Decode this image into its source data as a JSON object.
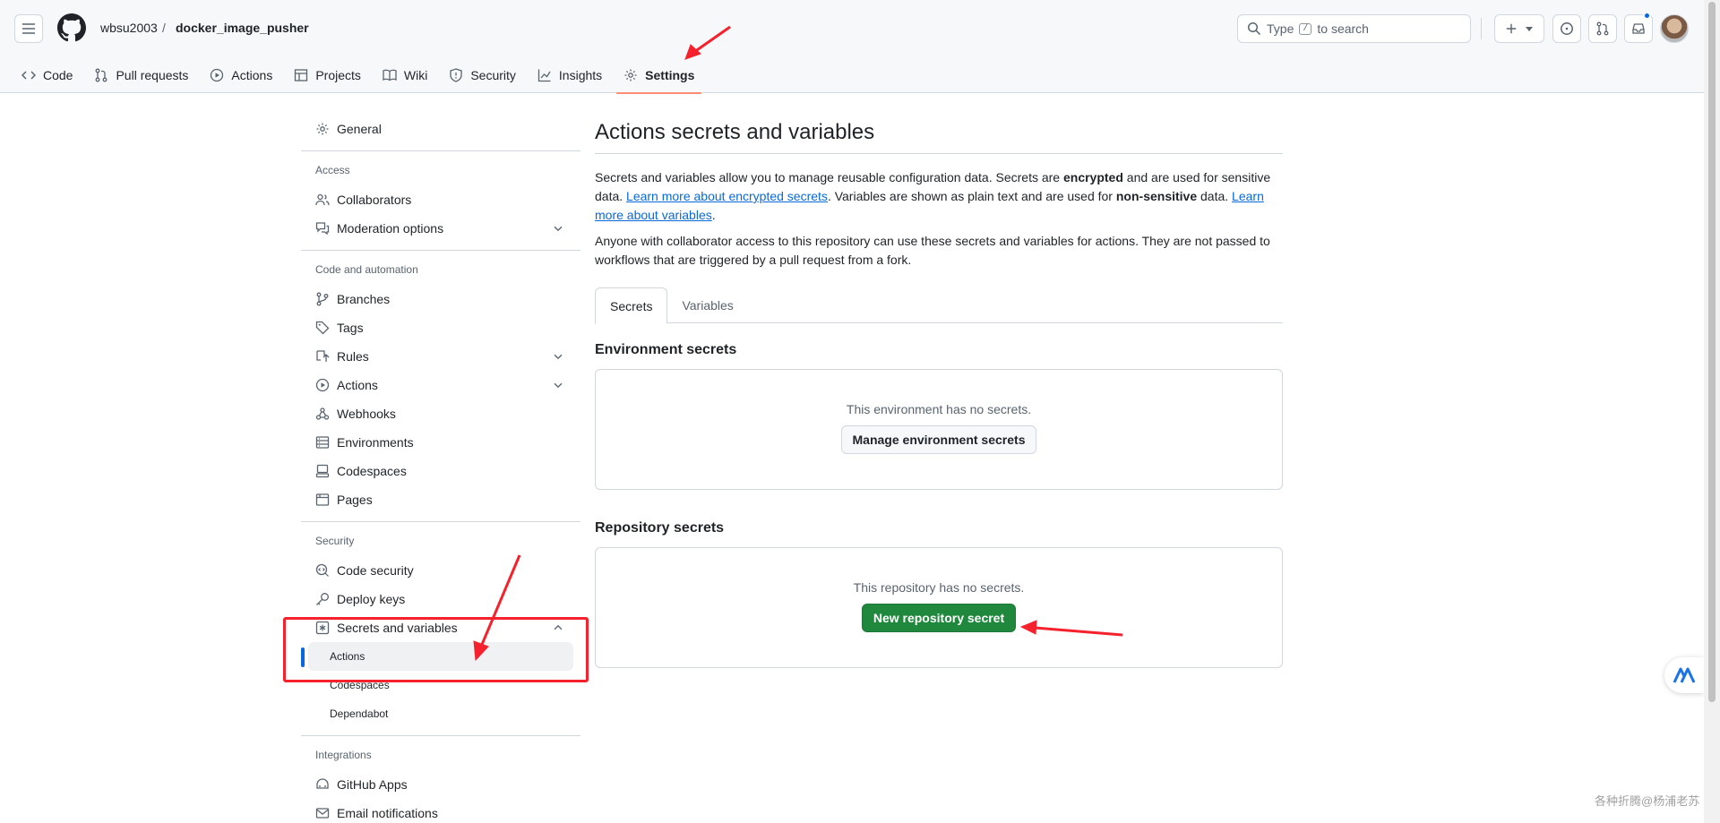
{
  "header": {
    "owner": "wbsu2003",
    "separator": "/",
    "repo": "docker_image_pusher",
    "search_prefix": "Type",
    "search_key": "/",
    "search_suffix": "to search"
  },
  "repo_nav": {
    "tabs": [
      {
        "label": "Code",
        "icon": "code-icon"
      },
      {
        "label": "Pull requests",
        "icon": "git-pull-request-icon"
      },
      {
        "label": "Actions",
        "icon": "play-icon"
      },
      {
        "label": "Projects",
        "icon": "table-icon"
      },
      {
        "label": "Wiki",
        "icon": "book-icon"
      },
      {
        "label": "Security",
        "icon": "shield-icon"
      },
      {
        "label": "Insights",
        "icon": "graph-icon"
      },
      {
        "label": "Settings",
        "icon": "gear-icon",
        "active": true
      }
    ]
  },
  "sidebar": {
    "general": "General",
    "access_heading": "Access",
    "collaborators": "Collaborators",
    "moderation": "Moderation options",
    "code_heading": "Code and automation",
    "branches": "Branches",
    "tags": "Tags",
    "rules": "Rules",
    "actions": "Actions",
    "webhooks": "Webhooks",
    "environments": "Environments",
    "codespaces": "Codespaces",
    "pages": "Pages",
    "security_heading": "Security",
    "code_security": "Code security",
    "deploy_keys": "Deploy keys",
    "secrets_vars": "Secrets and variables",
    "sub_actions": "Actions",
    "sub_codespaces": "Codespaces",
    "sub_dependabot": "Dependabot",
    "integrations_heading": "Integrations",
    "github_apps": "GitHub Apps",
    "email_notifications": "Email notifications"
  },
  "main": {
    "title": "Actions secrets and variables",
    "p1_a": "Secrets and variables allow you to manage reusable configuration data. Secrets are ",
    "p1_b": "encrypted",
    "p1_c": " and are used for sensitive data. ",
    "p1_link1": "Learn more about encrypted secrets",
    "p1_d": ". Variables are shown as plain text and are used for ",
    "p1_e": "non-sensitive",
    "p1_f": " data. ",
    "p1_link2": "Learn more about variables",
    "p1_g": ".",
    "p2": "Anyone with collaborator access to this repository can use these secrets and variables for actions. They are not passed to workflows that are triggered by a pull request from a fork.",
    "tab_secrets": "Secrets",
    "tab_variables": "Variables",
    "env_title": "Environment secrets",
    "env_empty": "This environment has no secrets.",
    "env_button": "Manage environment secrets",
    "repo_title": "Repository secrets",
    "repo_empty": "This repository has no secrets.",
    "repo_button": "New repository secret"
  },
  "watermark": "各种折腾@杨浦老苏",
  "colors": {
    "accent": "#0969da",
    "primary_button": "#1f883d",
    "annotation": "#f5222d",
    "active_tab_underline": "#fd8c73"
  }
}
